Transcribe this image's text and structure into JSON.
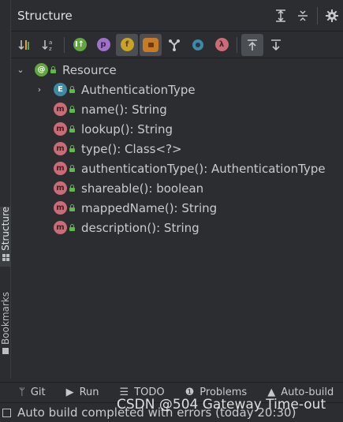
{
  "panel": {
    "title": "Structure"
  },
  "sidebar": {
    "tabs": [
      {
        "label": "Structure",
        "active": true
      },
      {
        "label": "Bookmarks",
        "active": false
      }
    ]
  },
  "toolbar": {
    "buttons": [
      {
        "name": "sort-by-visibility",
        "glyph": "↓⁼"
      },
      {
        "name": "sort-alphabetically",
        "glyph": "↓ᵃ"
      },
      {
        "name": "show-inherited",
        "glyph": "I"
      },
      {
        "name": "show-properties",
        "glyph": "p"
      },
      {
        "name": "show-fields",
        "glyph": "f"
      },
      {
        "name": "show-non-public",
        "glyph": ""
      },
      {
        "name": "show-anonymous",
        "glyph": "Y"
      },
      {
        "name": "show-interfaces",
        "glyph": "●"
      },
      {
        "name": "show-lambdas",
        "glyph": "λ"
      },
      {
        "name": "autoscroll-to-source",
        "glyph": "⇞"
      },
      {
        "name": "autoscroll-from-source",
        "glyph": "⇟"
      }
    ],
    "colors": {
      "inherited": "#62a63f",
      "properties": "#9f71c7",
      "fields": "#c9a227",
      "lock": "#c97a25",
      "interfaces": "#3f88a6",
      "lambdas": "#c86c77"
    }
  },
  "tree": {
    "root": {
      "label": "Resource",
      "icon": "@"
    },
    "items": [
      {
        "label": "AuthenticationType",
        "icon": "E",
        "kind": "enum",
        "expandable": true
      },
      {
        "label": "name(): String",
        "icon": "m",
        "kind": "method"
      },
      {
        "label": "lookup(): String",
        "icon": "m",
        "kind": "method"
      },
      {
        "label": "type(): Class<?>",
        "icon": "m",
        "kind": "method"
      },
      {
        "label": "authenticationType(): AuthenticationType",
        "icon": "m",
        "kind": "method"
      },
      {
        "label": "shareable(): boolean",
        "icon": "m",
        "kind": "method"
      },
      {
        "label": "mappedName(): String",
        "icon": "m",
        "kind": "method"
      },
      {
        "label": "description(): String",
        "icon": "m",
        "kind": "method"
      }
    ]
  },
  "bottom": {
    "tabs": [
      {
        "label": "Git",
        "icon": "git-branch-icon",
        "glyph": "ᛘ"
      },
      {
        "label": "Run",
        "icon": "play-icon",
        "glyph": "▶"
      },
      {
        "label": "TODO",
        "icon": "list-icon",
        "glyph": "☰"
      },
      {
        "label": "Problems",
        "icon": "info-icon",
        "glyph": "❶"
      },
      {
        "label": "Auto-build",
        "icon": "warning-icon",
        "glyph": "▲"
      }
    ]
  },
  "status": {
    "text": "Auto build completed with errors (today 20:30)"
  },
  "watermark": {
    "text": "CSDN @504 Gateway Time-out"
  }
}
